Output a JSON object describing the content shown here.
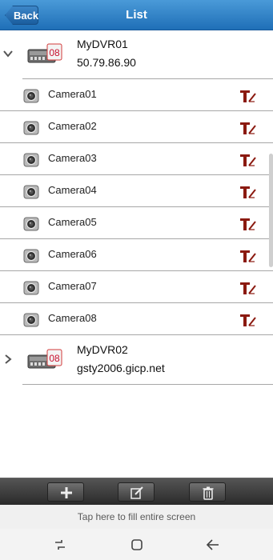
{
  "header": {
    "back_label": "Back",
    "title": "List"
  },
  "devices": [
    {
      "name": "MyDVR01",
      "address": "50.79.86.90",
      "expanded": true,
      "badge": "08"
    },
    {
      "name": "MyDVR02",
      "address": "gsty2006.gicp.net",
      "expanded": false,
      "badge": "08"
    }
  ],
  "cameras": [
    {
      "label": "Camera01"
    },
    {
      "label": "Camera02"
    },
    {
      "label": "Camera03"
    },
    {
      "label": "Camera04"
    },
    {
      "label": "Camera05"
    },
    {
      "label": "Camera06"
    },
    {
      "label": "Camera07"
    },
    {
      "label": "Camera08"
    }
  ],
  "toolbar": {
    "buttons": [
      "add-icon",
      "edit-icon",
      "trash-icon"
    ]
  },
  "fill_hint": "Tap here to fill entire screen",
  "navbar": {
    "buttons": [
      "recents-icon",
      "home-icon",
      "back-arrow-icon"
    ]
  },
  "colors": {
    "header_accent": "#2a7cc4",
    "edit_icon": "#8b1a10",
    "dvr_badge": "#c8102e"
  }
}
